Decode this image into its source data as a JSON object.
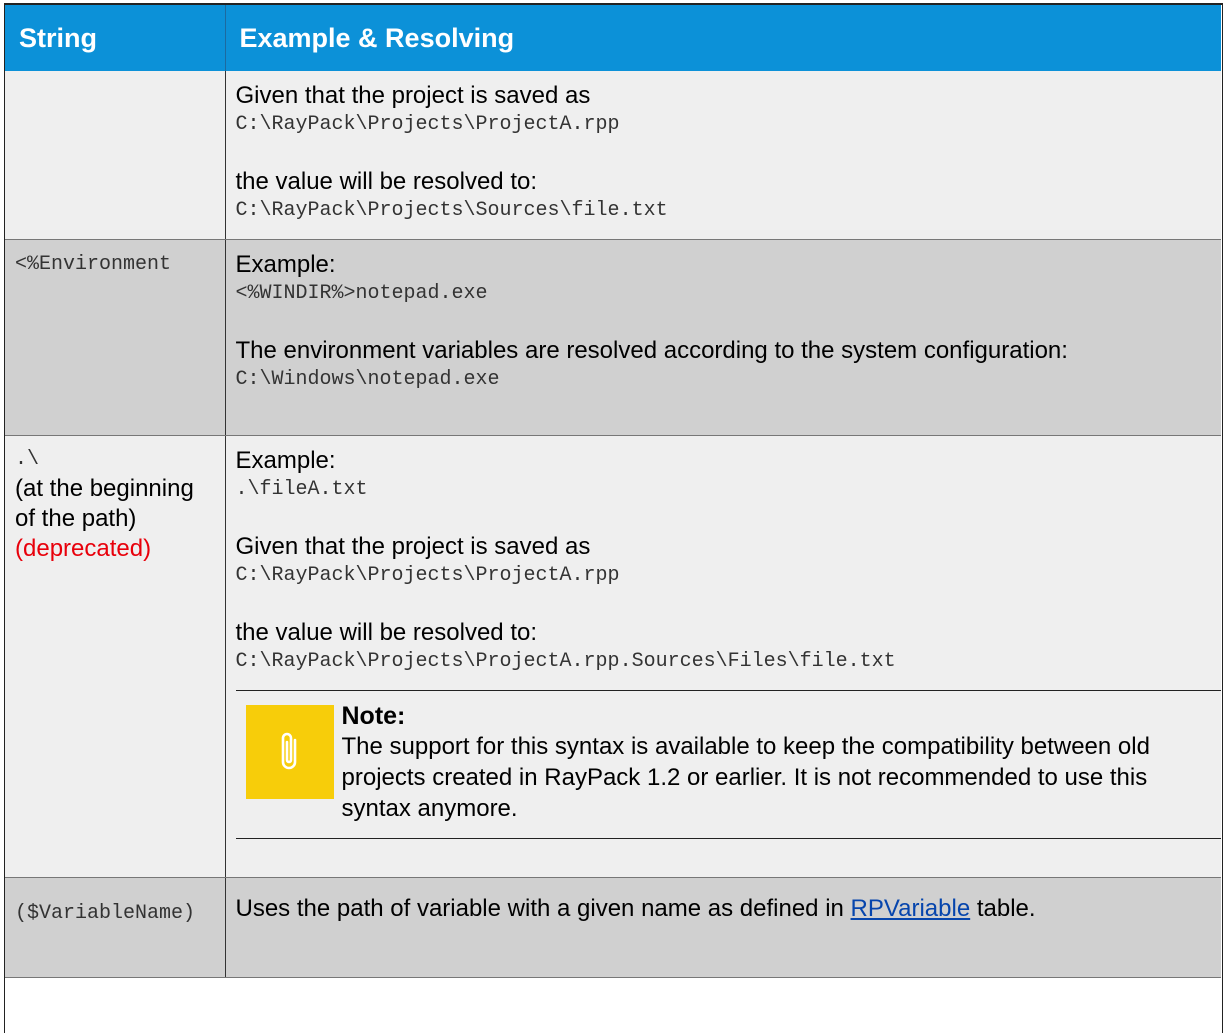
{
  "table": {
    "headers": {
      "string": "String",
      "example": "Example & Resolving"
    },
    "row1": {
      "line1": "Given that the project is saved as",
      "code1": "C:\\RayPack\\Projects\\ProjectA.rpp",
      "line2": "the value will be resolved to:",
      "code2": "C:\\RayPack\\Projects\\Sources\\file.txt"
    },
    "row2": {
      "string": "<%Environment",
      "line1": "Example:",
      "code1": "<%WINDIR%>notepad.exe",
      "line2": "The environment variables are resolved according to the system configuration:",
      "code2": "C:\\Windows\\notepad.exe"
    },
    "row3": {
      "string_code": ".\\",
      "string_text": "(at the beginning of the path)",
      "string_deprecated": "(deprecated)",
      "line1": "Example:",
      "code1": ".\\fileA.txt",
      "line2": "Given that the project is saved as",
      "code2": "C:\\RayPack\\Projects\\ProjectA.rpp",
      "line3": "the value will be resolved to:",
      "code3": "C:\\RayPack\\Projects\\ProjectA.rpp.Sources\\Files\\file.txt",
      "note": {
        "title": "Note:",
        "text": "The support for this syntax is available to keep the compatibility between old projects created in RayPack 1.2 or earlier. It is not recommended to use this syntax anymore.",
        "icon": "paperclip-icon"
      }
    },
    "row4": {
      "string": "($VariableName)",
      "text_before": "Uses the path of variable with a given name as defined in ",
      "link": "RPVariable",
      "text_after": " table."
    }
  },
  "colors": {
    "header": "#0c91d8",
    "note_icon_bg": "#f7cd0a",
    "deprecated": "#e8000b",
    "link": "#0645ad"
  }
}
